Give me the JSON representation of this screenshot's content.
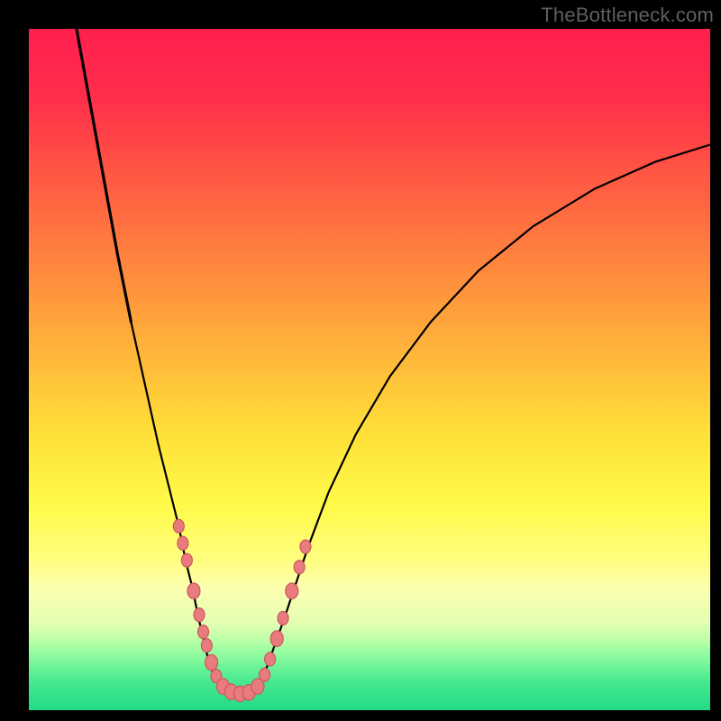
{
  "watermark": {
    "text": "TheBottleneck.com"
  },
  "chart_data": {
    "type": "line",
    "title": "",
    "xlabel": "",
    "ylabel": "",
    "xlim": [
      0,
      100
    ],
    "ylim": [
      0,
      100
    ],
    "background_gradient": [
      {
        "y": 0,
        "color": "#ff1f4f"
      },
      {
        "y": 10,
        "color": "#ff2e4a"
      },
      {
        "y": 20,
        "color": "#ff5244"
      },
      {
        "y": 30,
        "color": "#ff7640"
      },
      {
        "y": 40,
        "color": "#ff9a3c"
      },
      {
        "y": 50,
        "color": "#ffbe3a"
      },
      {
        "y": 60,
        "color": "#ffe239"
      },
      {
        "y": 70,
        "color": "#fffb4a"
      },
      {
        "y": 78,
        "color": "#fffe80"
      },
      {
        "y": 82,
        "color": "#fdffb0"
      },
      {
        "y": 87,
        "color": "#e5ffb3"
      },
      {
        "y": 90,
        "color": "#b6ffa7"
      },
      {
        "y": 93,
        "color": "#78f79a"
      },
      {
        "y": 96,
        "color": "#45e890"
      },
      {
        "y": 100,
        "color": "#22db87"
      }
    ],
    "series": [
      {
        "name": "left-curve",
        "x": [
          7,
          9,
          11,
          13,
          15,
          17,
          19,
          20.5,
          22,
          23,
          24,
          24.8,
          25.5,
          26.2,
          27,
          28,
          29
        ],
        "y": [
          0,
          11,
          22,
          33,
          43,
          52,
          61,
          67,
          73,
          78,
          82,
          86,
          89,
          92,
          94.5,
          96.5,
          97.3
        ]
      },
      {
        "name": "valley-floor",
        "x": [
          29,
          30,
          31,
          32,
          33
        ],
        "y": [
          97.3,
          97.6,
          97.7,
          97.6,
          97.3
        ]
      },
      {
        "name": "right-curve",
        "x": [
          33,
          34,
          35,
          36,
          37.5,
          39,
          41,
          44,
          48,
          53,
          59,
          66,
          74,
          83,
          92,
          100
        ],
        "y": [
          97.3,
          95.8,
          93.5,
          90.7,
          86.5,
          82,
          76,
          68,
          59.5,
          51,
          43,
          35.5,
          29,
          23.5,
          19.5,
          17
        ]
      }
    ],
    "markers": {
      "name": "highlighted-points",
      "color": "#e77b7e",
      "points": [
        {
          "x": 22.0,
          "y": 73.0,
          "r": 6
        },
        {
          "x": 22.6,
          "y": 75.5,
          "r": 6
        },
        {
          "x": 23.2,
          "y": 78.0,
          "r": 6
        },
        {
          "x": 24.2,
          "y": 82.5,
          "r": 7
        },
        {
          "x": 25.0,
          "y": 86.0,
          "r": 6
        },
        {
          "x": 25.6,
          "y": 88.5,
          "r": 6
        },
        {
          "x": 26.1,
          "y": 90.5,
          "r": 6
        },
        {
          "x": 26.8,
          "y": 93.0,
          "r": 7
        },
        {
          "x": 27.5,
          "y": 95.0,
          "r": 6
        },
        {
          "x": 28.5,
          "y": 96.5,
          "r": 7
        },
        {
          "x": 29.7,
          "y": 97.3,
          "r": 7
        },
        {
          "x": 31.0,
          "y": 97.6,
          "r": 7
        },
        {
          "x": 32.3,
          "y": 97.4,
          "r": 7
        },
        {
          "x": 33.6,
          "y": 96.5,
          "r": 7
        },
        {
          "x": 34.6,
          "y": 94.8,
          "r": 6
        },
        {
          "x": 35.4,
          "y": 92.5,
          "r": 6
        },
        {
          "x": 36.4,
          "y": 89.5,
          "r": 7
        },
        {
          "x": 37.3,
          "y": 86.5,
          "r": 6
        },
        {
          "x": 38.6,
          "y": 82.5,
          "r": 7
        },
        {
          "x": 39.7,
          "y": 79.0,
          "r": 6
        },
        {
          "x": 40.6,
          "y": 76.0,
          "r": 6
        }
      ]
    }
  }
}
